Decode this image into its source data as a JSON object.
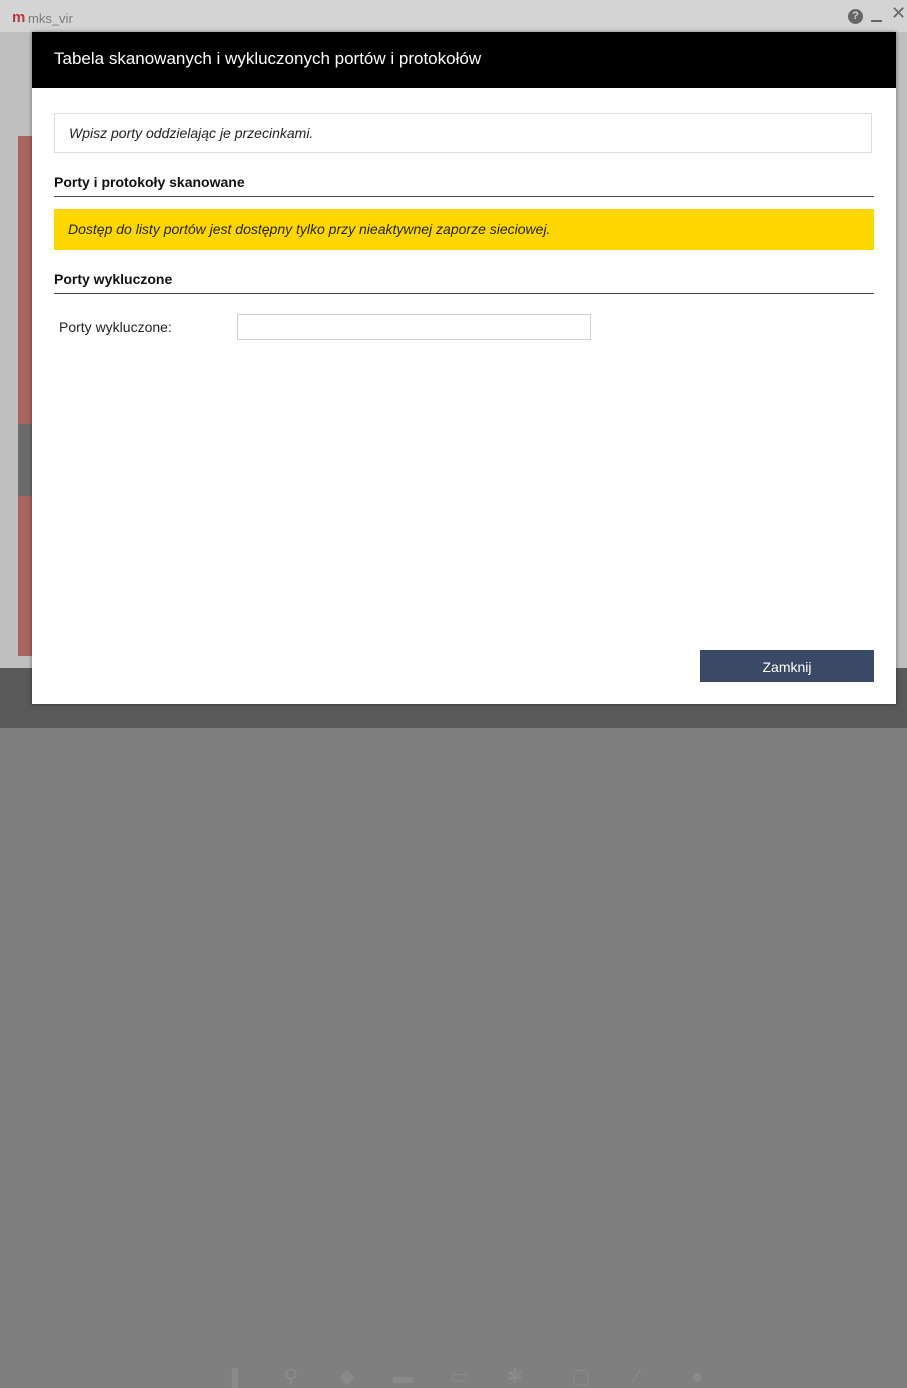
{
  "background_app": {
    "logo": "m",
    "app_name": "mks_vir",
    "help_icon": "question-circle-icon",
    "minimize_icon": "minimize-icon",
    "close_icon": "close-icon"
  },
  "dialog": {
    "title": "Tabela skanowanych i wykluczonych portów i protokołów",
    "hint": "Wpisz porty oddzielając je przecinkami.",
    "scanned_section": {
      "heading": "Porty i protokoły skanowane",
      "warning": "Dostęp do listy portów jest dostępny tylko przy nieaktywnej zaporze sieciowej."
    },
    "excluded_section": {
      "heading": "Porty wykluczone",
      "field_label": "Porty wykluczone:",
      "field_value": "",
      "field_placeholder": ""
    },
    "close_button_label": "Zamknij"
  },
  "colors": {
    "header_bg": "#000000",
    "warning_bg": "#ffd700",
    "button_bg": "#3a4a66"
  }
}
